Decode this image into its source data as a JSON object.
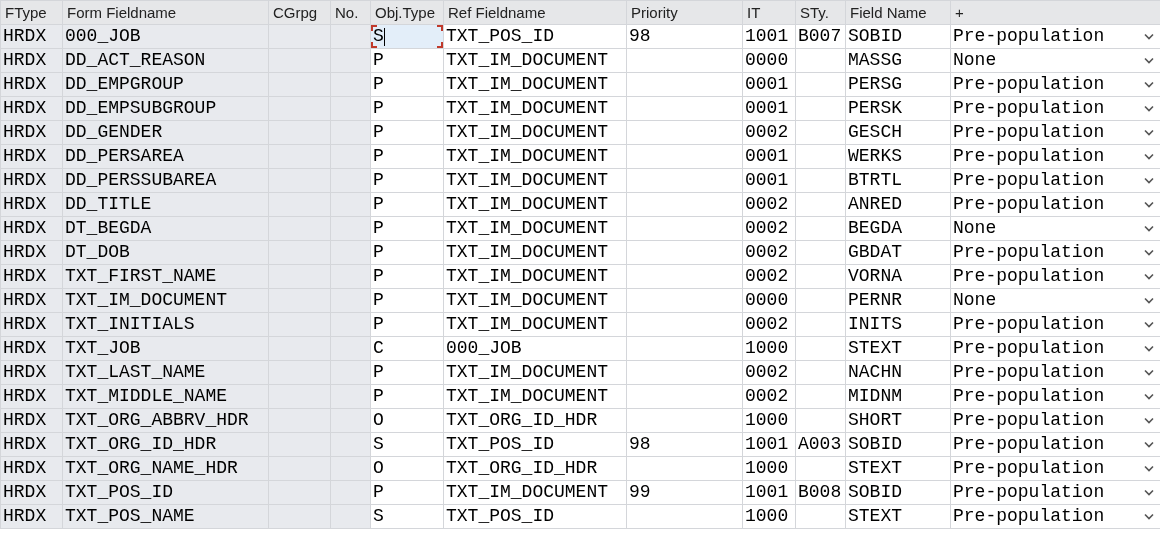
{
  "table": {
    "columns": [
      "FType",
      "Form Fieldname",
      "CGrpg",
      "No.",
      "Obj.Type",
      "Ref Fieldname",
      "Priority",
      "IT",
      "STy.",
      "Field Name",
      "+"
    ],
    "rows": [
      {
        "ftype": "HRDX",
        "form_fieldname": "000_JOB",
        "obj_type": "S",
        "focused": true,
        "ref_fieldname": "TXT_POS_ID",
        "priority": "98",
        "it": "1001",
        "sty": "B007",
        "field_name": "SOBID",
        "mode": "Pre-population"
      },
      {
        "ftype": "HRDX",
        "form_fieldname": "DD_ACT_REASON",
        "obj_type": "P",
        "focused": false,
        "ref_fieldname": "TXT_IM_DOCUMENT",
        "it": "0000",
        "field_name": "MASSG",
        "mode": "None"
      },
      {
        "ftype": "HRDX",
        "form_fieldname": "DD_EMPGROUP",
        "obj_type": "P",
        "focused": false,
        "ref_fieldname": "TXT_IM_DOCUMENT",
        "it": "0001",
        "field_name": "PERSG",
        "mode": "Pre-population"
      },
      {
        "ftype": "HRDX",
        "form_fieldname": "DD_EMPSUBGROUP",
        "obj_type": "P",
        "focused": false,
        "ref_fieldname": "TXT_IM_DOCUMENT",
        "it": "0001",
        "field_name": "PERSK",
        "mode": "Pre-population"
      },
      {
        "ftype": "HRDX",
        "form_fieldname": "DD_GENDER",
        "obj_type": "P",
        "focused": false,
        "ref_fieldname": "TXT_IM_DOCUMENT",
        "it": "0002",
        "field_name": "GESCH",
        "mode": "Pre-population"
      },
      {
        "ftype": "HRDX",
        "form_fieldname": "DD_PERSAREA",
        "obj_type": "P",
        "focused": false,
        "ref_fieldname": "TXT_IM_DOCUMENT",
        "it": "0001",
        "field_name": "WERKS",
        "mode": "Pre-population"
      },
      {
        "ftype": "HRDX",
        "form_fieldname": "DD_PERSSUBAREA",
        "obj_type": "P",
        "focused": false,
        "ref_fieldname": "TXT_IM_DOCUMENT",
        "it": "0001",
        "field_name": "BTRTL",
        "mode": "Pre-population"
      },
      {
        "ftype": "HRDX",
        "form_fieldname": "DD_TITLE",
        "obj_type": "P",
        "focused": false,
        "ref_fieldname": "TXT_IM_DOCUMENT",
        "it": "0002",
        "field_name": "ANRED",
        "mode": "Pre-population"
      },
      {
        "ftype": "HRDX",
        "form_fieldname": "DT_BEGDA",
        "obj_type": "P",
        "focused": false,
        "ref_fieldname": "TXT_IM_DOCUMENT",
        "it": "0002",
        "field_name": "BEGDA",
        "mode": "None"
      },
      {
        "ftype": "HRDX",
        "form_fieldname": "DT_DOB",
        "obj_type": "P",
        "focused": false,
        "ref_fieldname": "TXT_IM_DOCUMENT",
        "it": "0002",
        "field_name": "GBDAT",
        "mode": "Pre-population"
      },
      {
        "ftype": "HRDX",
        "form_fieldname": "TXT_FIRST_NAME",
        "obj_type": "P",
        "focused": false,
        "ref_fieldname": "TXT_IM_DOCUMENT",
        "it": "0002",
        "field_name": "VORNA",
        "mode": "Pre-population"
      },
      {
        "ftype": "HRDX",
        "form_fieldname": "TXT_IM_DOCUMENT",
        "obj_type": "P",
        "focused": false,
        "ref_fieldname": "TXT_IM_DOCUMENT",
        "it": "0000",
        "field_name": "PERNR",
        "mode": "None"
      },
      {
        "ftype": "HRDX",
        "form_fieldname": "TXT_INITIALS",
        "obj_type": "P",
        "focused": false,
        "ref_fieldname": "TXT_IM_DOCUMENT",
        "it": "0002",
        "field_name": "INITS",
        "mode": "Pre-population"
      },
      {
        "ftype": "HRDX",
        "form_fieldname": "TXT_JOB",
        "obj_type": "C",
        "focused": false,
        "ref_fieldname": "000_JOB",
        "it": "1000",
        "field_name": "STEXT",
        "mode": "Pre-population"
      },
      {
        "ftype": "HRDX",
        "form_fieldname": "TXT_LAST_NAME",
        "obj_type": "P",
        "focused": false,
        "ref_fieldname": "TXT_IM_DOCUMENT",
        "it": "0002",
        "field_name": "NACHN",
        "mode": "Pre-population"
      },
      {
        "ftype": "HRDX",
        "form_fieldname": "TXT_MIDDLE_NAME",
        "obj_type": "P",
        "focused": false,
        "ref_fieldname": "TXT_IM_DOCUMENT",
        "it": "0002",
        "field_name": "MIDNM",
        "mode": "Pre-population"
      },
      {
        "ftype": "HRDX",
        "form_fieldname": "TXT_ORG_ABBRV_HDR",
        "obj_type": "O",
        "focused": false,
        "ref_fieldname": "TXT_ORG_ID_HDR",
        "it": "1000",
        "field_name": "SHORT",
        "mode": "Pre-population"
      },
      {
        "ftype": "HRDX",
        "form_fieldname": "TXT_ORG_ID_HDR",
        "obj_type": "S",
        "focused": false,
        "ref_fieldname": "TXT_POS_ID",
        "priority": "98",
        "it": "1001",
        "sty": "A003",
        "field_name": "SOBID",
        "mode": "Pre-population"
      },
      {
        "ftype": "HRDX",
        "form_fieldname": "TXT_ORG_NAME_HDR",
        "obj_type": "O",
        "focused": false,
        "ref_fieldname": "TXT_ORG_ID_HDR",
        "it": "1000",
        "field_name": "STEXT",
        "mode": "Pre-population"
      },
      {
        "ftype": "HRDX",
        "form_fieldname": "TXT_POS_ID",
        "obj_type": "P",
        "focused": false,
        "ref_fieldname": "TXT_IM_DOCUMENT",
        "priority": "99",
        "it": "1001",
        "sty": "B008",
        "field_name": "SOBID",
        "mode": "Pre-population"
      },
      {
        "ftype": "HRDX",
        "form_fieldname": "TXT_POS_NAME",
        "obj_type": "S",
        "focused": false,
        "ref_fieldname": "TXT_POS_ID",
        "it": "1000",
        "field_name": "STEXT",
        "mode": "Pre-population"
      }
    ]
  }
}
